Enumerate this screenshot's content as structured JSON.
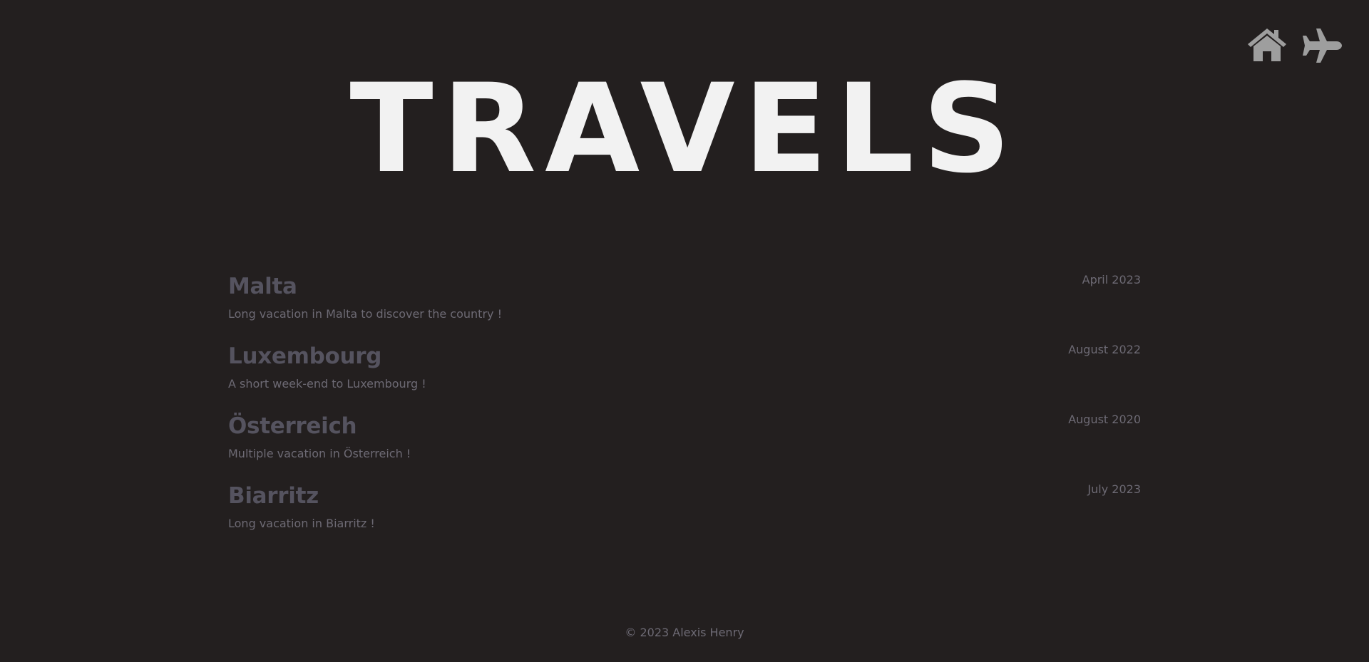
{
  "nav": {
    "home_icon": "home-icon",
    "travels_icon": "airplane-icon",
    "icon_color": "#9e9e9e"
  },
  "header": {
    "title": "TRAVELS"
  },
  "trips": [
    {
      "name": "Malta",
      "description": "Long vacation in Malta to discover the country !",
      "date": "April 2023"
    },
    {
      "name": "Luxembourg",
      "description": "A short week-end to Luxembourg !",
      "date": "August 2022"
    },
    {
      "name": "Österreich",
      "description": "Multiple vacation in Österreich !",
      "date": "August 2020"
    },
    {
      "name": "Biarritz",
      "description": "Long vacation in Biarritz !",
      "date": "July 2023"
    }
  ],
  "footer": {
    "text": "© 2023 Alexis Henry"
  },
  "colors": {
    "background": "#231f1f",
    "title": "#f2f2f2",
    "trip_name": "#55535f",
    "muted_text": "#6d6a74"
  }
}
